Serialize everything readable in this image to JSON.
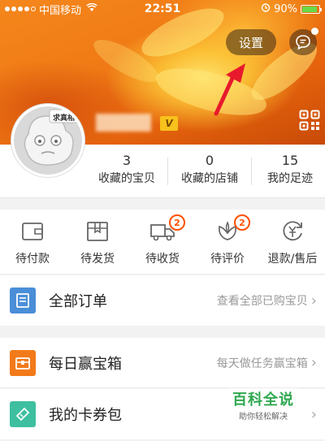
{
  "status_bar": {
    "carrier": "中国移动",
    "time": "22:51",
    "battery": "90%",
    "battery_level": 0.9
  },
  "header": {
    "settings_label": "设置",
    "vip_label": "V",
    "avatar_caption": "求真相"
  },
  "stats": [
    {
      "value": "3",
      "label": "收藏的宝贝"
    },
    {
      "value": "0",
      "label": "收藏的店铺"
    },
    {
      "value": "15",
      "label": "我的足迹"
    }
  ],
  "orders": [
    {
      "label": "待付款",
      "icon": "wallet-icon",
      "badge": ""
    },
    {
      "label": "待发货",
      "icon": "package-icon",
      "badge": ""
    },
    {
      "label": "待收货",
      "icon": "truck-icon",
      "badge": "2"
    },
    {
      "label": "待评价",
      "icon": "flower-icon",
      "badge": "2"
    },
    {
      "label": "退款/售后",
      "icon": "refund-icon",
      "badge": ""
    }
  ],
  "list": {
    "all_orders": {
      "title": "全部订单",
      "sub": "查看全部已购宝贝",
      "color": "#4a8ed8"
    },
    "daily_box": {
      "title": "每日赢宝箱",
      "sub": "每天做任务赢宝箱",
      "color": "#f27a1a"
    },
    "coupons": {
      "title": "我的卡券包",
      "sub": "",
      "color": "#3dbfa0"
    }
  },
  "watermark": {
    "title": "百科全说",
    "sub": "助你轻松解决"
  }
}
